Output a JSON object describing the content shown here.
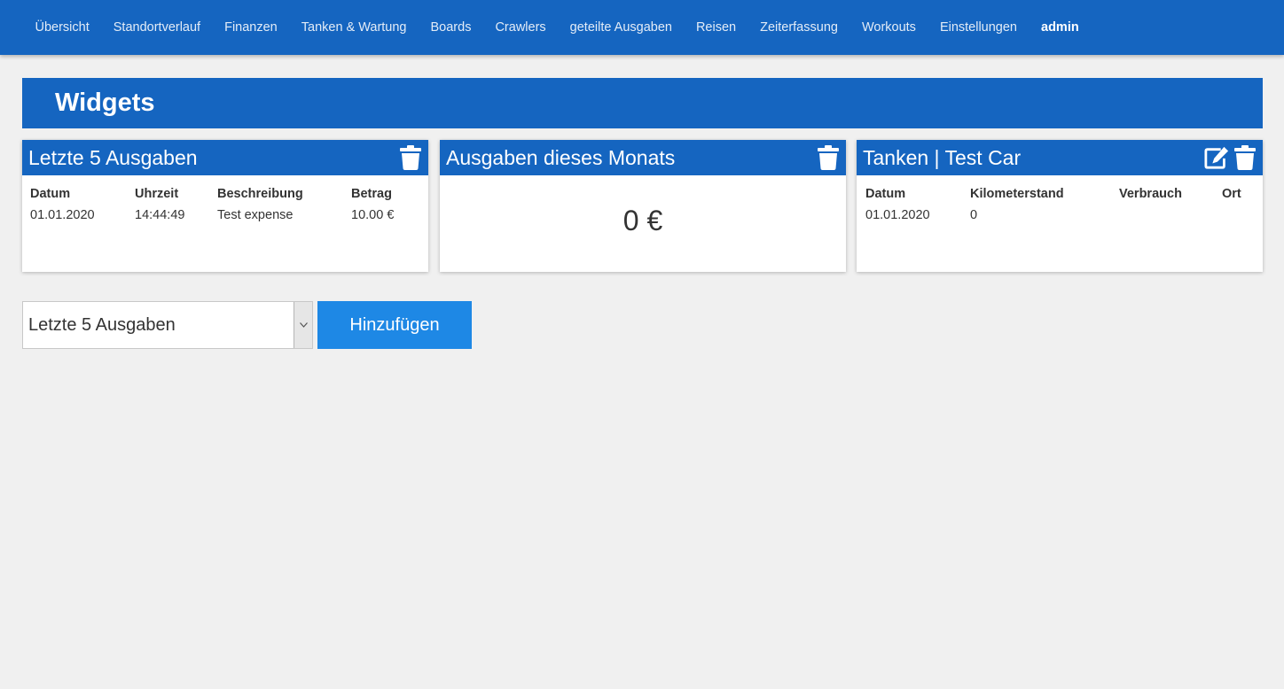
{
  "nav": {
    "items": [
      {
        "label": "Übersicht",
        "active": false
      },
      {
        "label": "Standortverlauf",
        "active": false
      },
      {
        "label": "Finanzen",
        "active": false
      },
      {
        "label": "Tanken & Wartung",
        "active": false
      },
      {
        "label": "Boards",
        "active": false
      },
      {
        "label": "Crawlers",
        "active": false
      },
      {
        "label": "geteilte Ausgaben",
        "active": false
      },
      {
        "label": "Reisen",
        "active": false
      },
      {
        "label": "Zeiterfassung",
        "active": false
      },
      {
        "label": "Workouts",
        "active": false
      },
      {
        "label": "Einstellungen",
        "active": false
      },
      {
        "label": "admin",
        "active": true
      }
    ]
  },
  "page": {
    "title": "Widgets"
  },
  "widgets": {
    "expenses": {
      "title": "Letzte 5 Ausgaben",
      "columns": [
        "Datum",
        "Uhrzeit",
        "Beschreibung",
        "Betrag"
      ],
      "rows": [
        [
          "01.01.2020",
          "14:44:49",
          "Test expense",
          "10.00 €"
        ]
      ]
    },
    "month": {
      "title": "Ausgaben dieses Monats",
      "value": "0 €"
    },
    "fuel": {
      "title": "Tanken | Test Car",
      "columns": [
        "Datum",
        "Kilometerstand",
        "Verbrauch",
        "Ort"
      ],
      "rows": [
        [
          "01.01.2020",
          "0",
          "",
          ""
        ]
      ]
    }
  },
  "add_widget": {
    "selected": "Letzte 5 Ausgaben",
    "button_label": "Hinzufügen"
  },
  "colors": {
    "primary": "#1565c0",
    "button": "#1e88e5",
    "background": "#f0f0f0"
  },
  "icons": {
    "delete": "trash-icon",
    "edit": "edit-icon",
    "dropdown": "chevron-down-icon"
  }
}
